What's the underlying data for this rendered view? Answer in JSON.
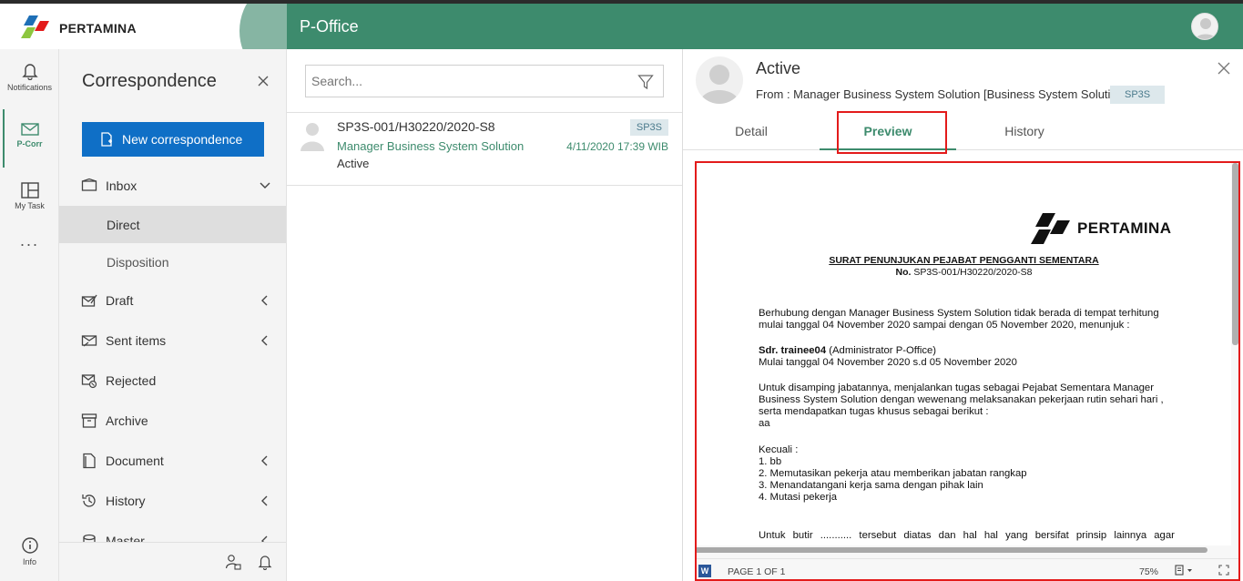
{
  "brand": {
    "logo_text": "PERTAMINA",
    "primary_color": "#3d8b6d",
    "accent_blue": "#0f6fc6",
    "highlight_red": "#e31b1b"
  },
  "header": {
    "app_title": "P-Office"
  },
  "rail": {
    "items": [
      {
        "label": "Notifications",
        "icon": "bell-icon"
      },
      {
        "label": "P-Corr",
        "icon": "mail-icon"
      },
      {
        "label": "My Task",
        "icon": "tasks-icon"
      },
      {
        "label": "Info",
        "icon": "info-icon"
      }
    ],
    "more": "..."
  },
  "nav": {
    "title": "Correspondence",
    "new_button": "New correspondence",
    "items": [
      {
        "label": "Inbox",
        "icon": "inbox-icon",
        "chevron": "down"
      },
      {
        "label": "Direct"
      },
      {
        "label": "Disposition"
      },
      {
        "label": "Draft",
        "icon": "draft-icon",
        "chevron": "left"
      },
      {
        "label": "Sent items",
        "icon": "sent-icon",
        "chevron": "left"
      },
      {
        "label": "Rejected",
        "icon": "rejected-icon"
      },
      {
        "label": "Archive",
        "icon": "archive-icon"
      },
      {
        "label": "Document",
        "icon": "document-icon",
        "chevron": "left"
      },
      {
        "label": "History",
        "icon": "history-icon",
        "chevron": "left"
      },
      {
        "label": "Master",
        "icon": "master-icon",
        "chevron": "left"
      }
    ]
  },
  "list": {
    "search_placeholder": "Search...",
    "rows": [
      {
        "title": "SP3S-001/H30220/2020-S8",
        "sender": "Manager Business System Solution",
        "status": "Active",
        "badge": "SP3S",
        "time": "4/11/2020 17:39 WIB"
      }
    ]
  },
  "detail": {
    "title": "Active",
    "from": "From : Manager Business System Solution [Business System Solution]",
    "badge": "SP3S",
    "tabs": [
      "Detail",
      "Preview",
      "History"
    ],
    "active_tab": "Preview"
  },
  "document": {
    "logo_text": "PERTAMINA",
    "heading": "SURAT PENUNJUKAN PEJABAT PENGGANTI SEMENTARA",
    "no_label": "No.",
    "no_value": "SP3S-001/H30220/2020-S8",
    "p1_line1": "Berhubung dengan Manager Business System Solution tidak berada di tempat terhitung",
    "p1_line2": "mulai tanggal 04 November 2020 sampai dengan 05 November 2020, menunjuk :",
    "person_name": "Sdr. trainee04",
    "person_role": "(Administrator P-Office)",
    "person_dates": "Mulai tanggal 04 November 2020 s.d 05 November 2020",
    "p2_line1": "Untuk disamping jabatannya, menjalankan tugas sebagai Pejabat Sementara Manager",
    "p2_line2": "Business System Solution dengan wewenang melaksanakan pekerjaan rutin sehari hari ,",
    "p2_line3": "serta mendapatkan tugas khusus sebagai berikut :",
    "p2_line4": "aa",
    "except_label": "Kecuali :",
    "except_items": [
      "1. bb",
      "2. Memutasikan pekerja atau memberikan jabatan rangkap",
      "3. Menandatangani kerja sama dengan pihak lain",
      "4. Mutasi pekerja"
    ],
    "p3_line1": "Untuk butir ........... tersebut diatas dan hal hal yang bersifat prinsip lainnya agar"
  },
  "viewer": {
    "page_info": "PAGE 1 OF 1",
    "zoom": "75%",
    "file_icon": "word-icon"
  }
}
